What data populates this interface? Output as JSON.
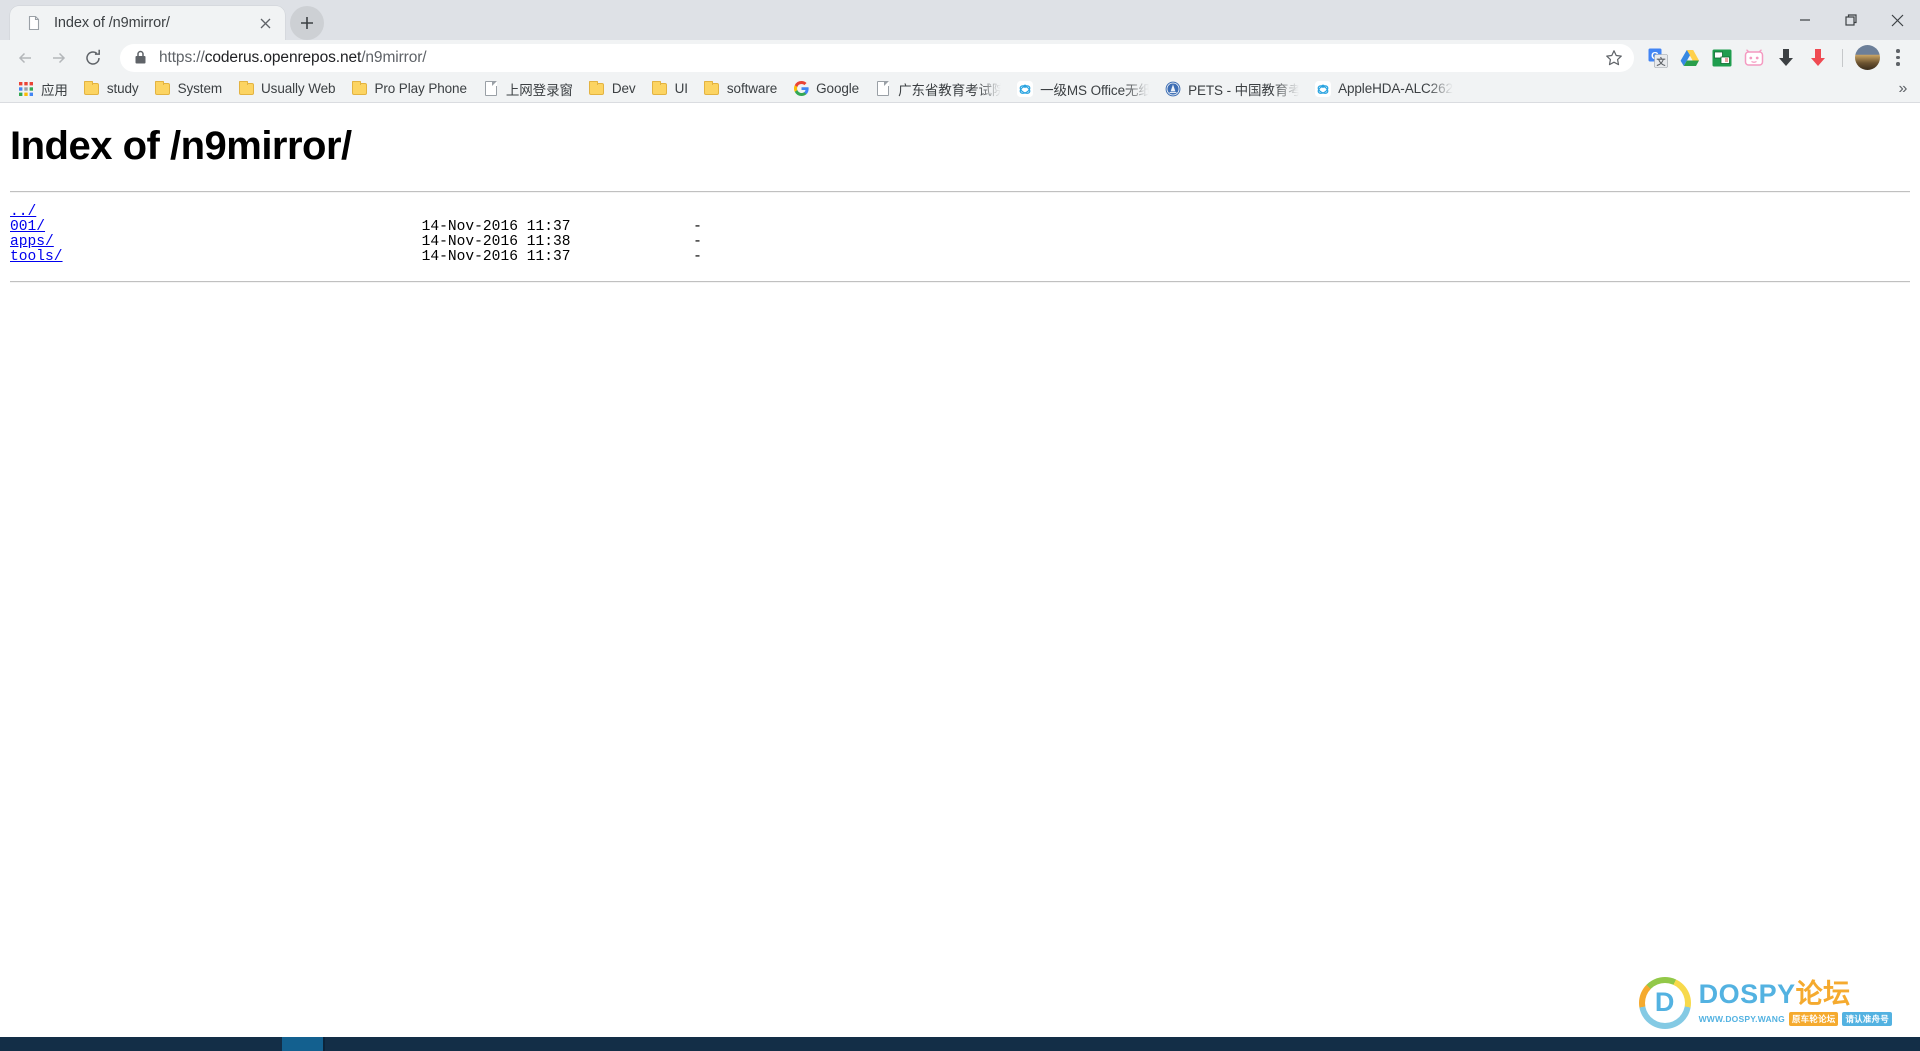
{
  "window": {
    "controls": [
      {
        "name": "minimize",
        "glyph": "minimize-icon"
      },
      {
        "name": "maximize",
        "glyph": "restore-icon"
      },
      {
        "name": "close",
        "glyph": "close-icon"
      }
    ]
  },
  "tab": {
    "title": "Index of /n9mirror/",
    "favicon": "document-icon",
    "close_label": "×",
    "newtab_label": "+"
  },
  "toolbar": {
    "back_label": "←",
    "forward_label": "→",
    "reload_label": "↻",
    "security": "lock-icon",
    "url_full": "https://coderus.openrepos.net/n9mirror/",
    "url_scheme": "https://",
    "url_host": "coderus.openrepos.net",
    "url_path": "/n9mirror/",
    "bookmark_star": "star-icon",
    "extensions": [
      {
        "name": "google-translate-icon",
        "label": "G"
      },
      {
        "name": "google-drive-icon",
        "label": ""
      },
      {
        "name": "green-clipper-icon",
        "label": ""
      },
      {
        "name": "pink-tv-icon",
        "label": ""
      },
      {
        "name": "download-dark-icon",
        "label": ""
      },
      {
        "name": "download-red-icon",
        "label": ""
      }
    ],
    "profile_avatar": "avatar",
    "menu": "three-dot-menu-icon"
  },
  "bookmarks": {
    "apps_label": "应用",
    "overflow_label": "»",
    "items": [
      {
        "label": "study",
        "icon": "folder-icon"
      },
      {
        "label": "System",
        "icon": "folder-icon"
      },
      {
        "label": "Usually Web",
        "icon": "folder-icon"
      },
      {
        "label": "Pro Play Phone",
        "icon": "folder-icon"
      },
      {
        "label": "上网登录窗",
        "icon": "document-icon"
      },
      {
        "label": "Dev",
        "icon": "folder-icon"
      },
      {
        "label": "UI",
        "icon": "folder-icon"
      },
      {
        "label": "software",
        "icon": "folder-icon"
      },
      {
        "label": "Google",
        "icon": "google-icon"
      },
      {
        "label": "广东省教育考试院",
        "icon": "document-icon"
      },
      {
        "label": "一级MS Office无纸化",
        "icon": "atom-blue-icon"
      },
      {
        "label": "PETS - 中国教育考试",
        "icon": "seal-blue-icon"
      },
      {
        "label": "AppleHDA-ALC262",
        "icon": "atom-blue-icon"
      }
    ]
  },
  "page": {
    "heading": "Index of /n9mirror/",
    "listing": [
      {
        "name": "../",
        "date": "",
        "size": ""
      },
      {
        "name": "001/",
        "date": "14-Nov-2016 11:37",
        "size": "-"
      },
      {
        "name": "apps/",
        "date": "14-Nov-2016 11:38",
        "size": "-"
      },
      {
        "name": "tools/",
        "date": "14-Nov-2016 11:37",
        "size": "-"
      }
    ]
  },
  "watermark": {
    "mark": "D",
    "brand_en": "DOSPY",
    "brand_cn": "论坛",
    "url": "WWW.DOSPY.WANG",
    "tag1": "原车轮论坛",
    "tag2": "请认准舟号"
  },
  "colors": {
    "tabstrip": "#dee1e6",
    "toolbar": "#f1f3f4",
    "link": "#0000ee",
    "accent_blue": "#4aaee0",
    "accent_orange": "#f5a623",
    "taskbar": "#132e47",
    "taskbar_active": "#13608f"
  }
}
